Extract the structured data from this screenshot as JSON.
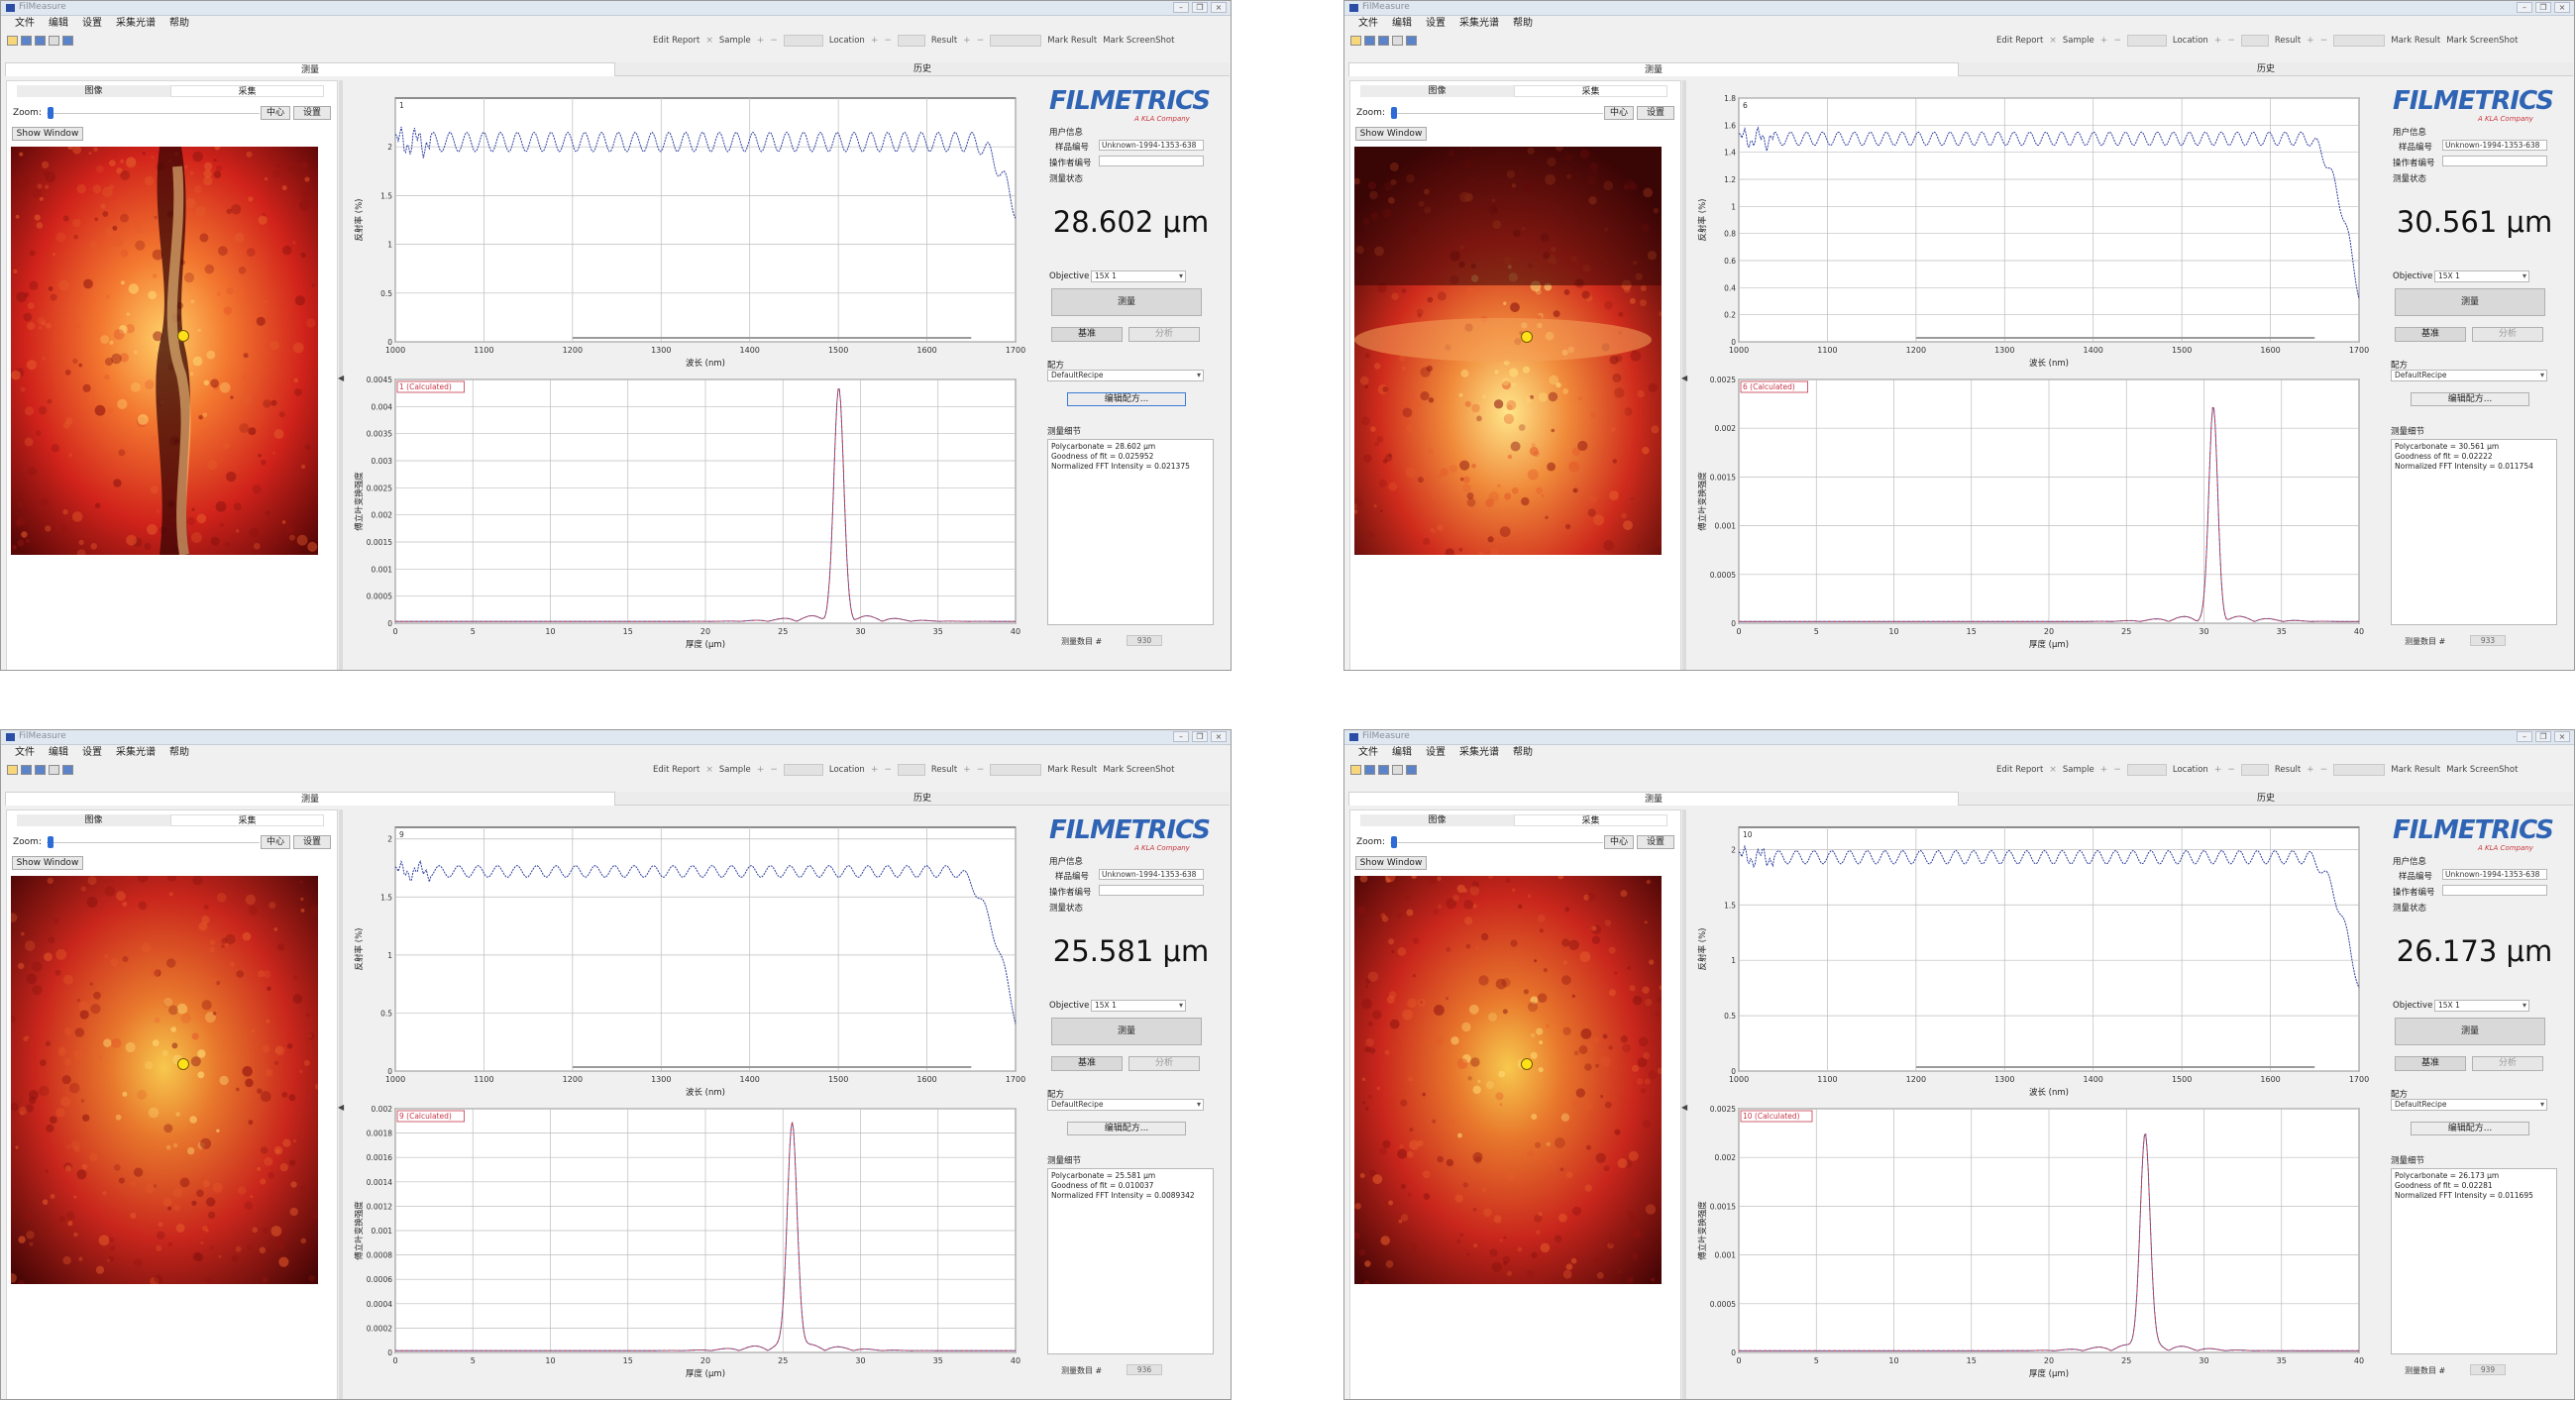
{
  "window": {
    "title": "FilMeasure",
    "controls": [
      "–",
      "❐",
      "×"
    ]
  },
  "menu": [
    "文件",
    "编辑",
    "设置",
    "采集光谱",
    "帮助"
  ],
  "toolbar": {
    "edit_report": "Edit Report",
    "sample": "Sample",
    "location": "Location",
    "result": "Result",
    "mark_result": "Mark Result",
    "mark_screenshot": "Mark ScreenShot",
    "icons": [
      "new-file-icon",
      "open-folder-icon",
      "save-icon",
      "copy-icon",
      "print-icon"
    ]
  },
  "tabs": {
    "measure": "测量",
    "history": "历史"
  },
  "image_panel": {
    "tab_image": "图像",
    "tab_camera": "采集",
    "zoom_label": "Zoom:",
    "zoom_level": 0.02,
    "center_button": "中心",
    "set_button": "设置",
    "show_window": "Show Window"
  },
  "info_panel": {
    "logo": "FILMETRICS",
    "logo_sub": "A KLA Company",
    "user_info": "用户信息",
    "sample_id_label": "样品编号",
    "sample_id": "Unknown-1994-1353-638",
    "operator_label": "操作者编号",
    "status_label": "测量状态",
    "objective_label": "Objective",
    "objective_value": "15X 1",
    "measure_button": "测量",
    "baseline_button": "基准",
    "analyze_button": "分析",
    "recipe_label": "配方",
    "recipe_value": "DefaultRecipe",
    "edit_recipe_button": "编辑配方...",
    "details_label": "测量细节",
    "count_label": "测量数目 #"
  },
  "colors": {
    "spectrum_line": "#2f3fa0",
    "fft_line": "#c8384a",
    "logo_blue": "#2f64b5",
    "logo_red": "#c9343a"
  },
  "measurements": [
    {
      "thickness": "28.602 μm",
      "result_lines": [
        "Polycarbonate = 28.602 μm",
        "Goodness of fit = 0.025952",
        "Normalized FFT Intensity = 0.021375"
      ],
      "count": "930",
      "spectrum_tag": "1",
      "fft_tag": "1 (Calculated)",
      "edit_focused": true,
      "camera": "dark vertical scratch across red-orange field, bright orange center band"
    },
    {
      "thickness": "30.561 μm",
      "result_lines": [
        "Polycarbonate = 30.561 μm",
        "Goodness of fit = 0.02222",
        "Normalized FFT Intensity = 0.011754"
      ],
      "count": "933",
      "spectrum_tag": "6",
      "fft_tag": "6 (Calculated)",
      "edit_focused": false,
      "camera": "red field with darker upper half, horizontal bright streak and yellow lower glow"
    },
    {
      "thickness": "25.581 μm",
      "result_lines": [
        "Polycarbonate = 25.581 μm",
        "Goodness of fit = 0.010037",
        "Normalized FFT Intensity = 0.0089342"
      ],
      "count": "936",
      "spectrum_tag": "9",
      "fft_tag": "9 (Calculated)",
      "edit_focused": false,
      "camera": "mottled red field with speckled yellow-orange center"
    },
    {
      "thickness": "26.173 μm",
      "result_lines": [
        "Polycarbonate = 26.173 μm",
        "Goodness of fit = 0.02281",
        "Normalized FFT Intensity = 0.011695"
      ],
      "count": "939",
      "spectrum_tag": "10",
      "fft_tag": "10 (Calculated)",
      "edit_focused": false,
      "camera": "mottled red field with speckled yellow-orange center"
    }
  ],
  "chart_data": [
    {
      "type": "line",
      "panel": 1,
      "chart": "reflectance",
      "xlabel": "波长 (nm)",
      "ylabel": "反射率 (%)",
      "xlim": [
        1000,
        1700
      ],
      "ylim": [
        0,
        2.5
      ],
      "xticks": [
        1000,
        1100,
        1200,
        1300,
        1400,
        1500,
        1600,
        1700
      ],
      "yticks": [
        0,
        0.5,
        1,
        1.5,
        2
      ],
      "ytick_labels": [
        "0",
        "0.5",
        "1",
        "1.5",
        "2"
      ],
      "series": [
        {
          "base": 2.05,
          "amp": 0.1,
          "period_nm": 19,
          "drop_start_nm": 1650,
          "drop_to": 1.35
        }
      ]
    },
    {
      "type": "line",
      "panel": 1,
      "chart": "fft",
      "xlabel": "厚度 (μm)",
      "ylabel": "傅立叶变换强度",
      "xlim": [
        0,
        40
      ],
      "ylim": [
        0,
        0.0045
      ],
      "xticks": [
        0,
        5,
        10,
        15,
        20,
        25,
        30,
        35,
        40
      ],
      "yticks": [
        0,
        0.0005,
        0.001,
        0.0015,
        0.002,
        0.0025,
        0.003,
        0.0035,
        0.004,
        0.0045
      ],
      "ytick_labels": [
        "0",
        "0.0005",
        "0.001",
        "0.0015",
        "0.002",
        "0.0025",
        "0.003",
        "0.0035",
        "0.004",
        "0.0045"
      ],
      "series": [
        {
          "peak_x": 28.6,
          "peak_y": 0.0042,
          "width": 0.45
        }
      ]
    },
    {
      "type": "line",
      "panel": 2,
      "chart": "reflectance",
      "xlabel": "波长 (nm)",
      "ylabel": "反射率 (%)",
      "xlim": [
        1000,
        1700
      ],
      "ylim": [
        0,
        1.8
      ],
      "xticks": [
        1000,
        1100,
        1200,
        1300,
        1400,
        1500,
        1600,
        1700
      ],
      "yticks": [
        0,
        0.2,
        0.4,
        0.6,
        0.8,
        1,
        1.2,
        1.4,
        1.6,
        1.8
      ],
      "ytick_labels": [
        "0",
        "0.2",
        "0.4",
        "0.6",
        "0.8",
        "1",
        "1.2",
        "1.4",
        "1.6",
        "1.8"
      ],
      "series": [
        {
          "base": 1.5,
          "amp": 0.05,
          "period_nm": 18,
          "drop_start_nm": 1640,
          "drop_to": 0.35
        }
      ]
    },
    {
      "type": "line",
      "panel": 2,
      "chart": "fft",
      "xlabel": "厚度 (μm)",
      "ylabel": "傅立叶变换强度",
      "xlim": [
        0,
        40
      ],
      "ylim": [
        0,
        0.0025
      ],
      "xticks": [
        0,
        5,
        10,
        15,
        20,
        25,
        30,
        35,
        40
      ],
      "yticks": [
        0,
        0.0005,
        0.001,
        0.0015,
        0.002,
        0.0025
      ],
      "ytick_labels": [
        "0",
        "0.0005",
        "0.001",
        "0.0015",
        "0.002",
        "0.0025"
      ],
      "series": [
        {
          "peak_x": 30.6,
          "peak_y": 0.00215,
          "width": 0.4
        }
      ]
    },
    {
      "type": "line",
      "panel": 3,
      "chart": "reflectance",
      "xlabel": "波长 (nm)",
      "ylabel": "反射率 (%)",
      "xlim": [
        1000,
        1700
      ],
      "ylim": [
        0,
        2.1
      ],
      "xticks": [
        1000,
        1100,
        1200,
        1300,
        1400,
        1500,
        1600,
        1700
      ],
      "yticks": [
        0,
        0.5,
        1,
        1.5,
        2
      ],
      "ytick_labels": [
        "0",
        "0.5",
        "1",
        "1.5",
        "2"
      ],
      "series": [
        {
          "base": 1.72,
          "amp": 0.05,
          "period_nm": 22,
          "drop_start_nm": 1630,
          "drop_to": 0.45
        }
      ]
    },
    {
      "type": "line",
      "panel": 3,
      "chart": "fft",
      "xlabel": "厚度 (μm)",
      "ylabel": "傅立叶变换强度",
      "xlim": [
        0,
        40
      ],
      "ylim": [
        0,
        0.002
      ],
      "xticks": [
        0,
        5,
        10,
        15,
        20,
        25,
        30,
        35,
        40
      ],
      "yticks": [
        0,
        0.0002,
        0.0004,
        0.0006,
        0.0008,
        0.001,
        0.0012,
        0.0014,
        0.0016,
        0.0018,
        0.002
      ],
      "ytick_labels": [
        "0",
        "0.0002",
        "0.0004",
        "0.0006",
        "0.0008",
        "0.001",
        "0.0012",
        "0.0014",
        "0.0016",
        "0.0018",
        "0.002"
      ],
      "series": [
        {
          "peak_x": 25.6,
          "peak_y": 0.00185,
          "width": 0.45
        }
      ]
    },
    {
      "type": "line",
      "panel": 4,
      "chart": "reflectance",
      "xlabel": "波长 (nm)",
      "ylabel": "反射率 (%)",
      "xlim": [
        1000,
        1700
      ],
      "ylim": [
        0,
        2.2
      ],
      "xticks": [
        1000,
        1100,
        1200,
        1300,
        1400,
        1500,
        1600,
        1700
      ],
      "yticks": [
        0,
        0.5,
        1,
        1.5,
        2
      ],
      "ytick_labels": [
        "0",
        "0.5",
        "1",
        "1.5",
        "2"
      ],
      "series": [
        {
          "base": 1.93,
          "amp": 0.06,
          "period_nm": 20,
          "drop_start_nm": 1640,
          "drop_to": 0.75
        }
      ]
    },
    {
      "type": "line",
      "panel": 4,
      "chart": "fft",
      "xlabel": "厚度 (μm)",
      "ylabel": "傅立叶变换强度",
      "xlim": [
        0,
        40
      ],
      "ylim": [
        0,
        0.0025
      ],
      "xticks": [
        0,
        5,
        10,
        15,
        20,
        25,
        30,
        35,
        40
      ],
      "yticks": [
        0,
        0.0005,
        0.001,
        0.0015,
        0.002,
        0.0025
      ],
      "ytick_labels": [
        "0",
        "0.0005",
        "0.001",
        "0.0015",
        "0.002",
        "0.0025"
      ],
      "series": [
        {
          "peak_x": 26.2,
          "peak_y": 0.0022,
          "width": 0.45
        }
      ]
    }
  ]
}
